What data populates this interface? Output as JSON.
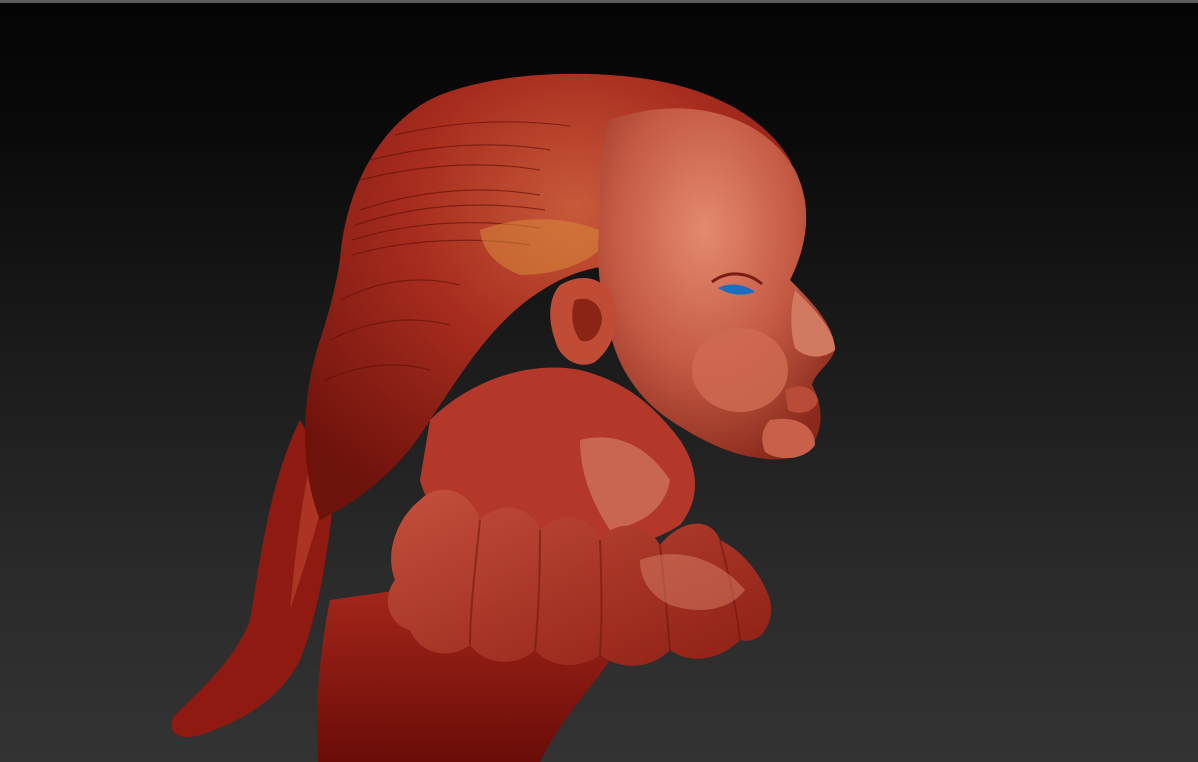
{
  "viewport": {
    "subject": "sculpt-model",
    "background_top": "#040404",
    "background_bottom": "#333333",
    "primary_color": "#b82a1c",
    "skin_color": "#c56048",
    "eye_color": "#1b6fc0"
  }
}
